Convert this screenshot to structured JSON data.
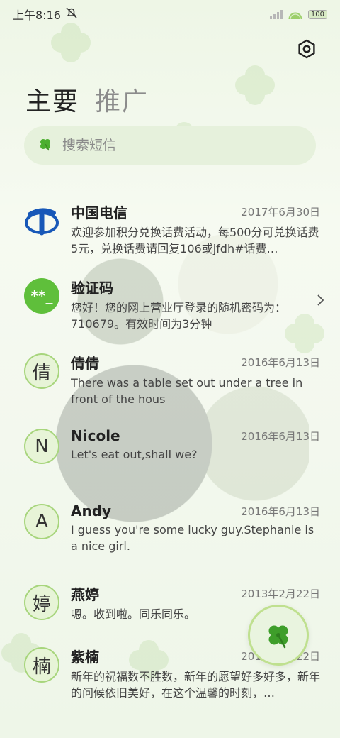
{
  "status_bar": {
    "time": "上午8:16",
    "battery": "100"
  },
  "tabs": [
    {
      "label": "主要"
    },
    {
      "label": "推广"
    }
  ],
  "search": {
    "placeholder": "搜索短信"
  },
  "conversations": [
    {
      "name": "中国电信",
      "date": "2017年6月30日",
      "preview": "欢迎参加积分兑换话费活动，每500分可兑换话费5元，兑换话费请回复106或jfdh#话费…",
      "avatar": ""
    },
    {
      "name": "验证码",
      "date": "",
      "preview": "您好！您的网上营业厅登录的随机密码为：710679。有效时间为3分钟",
      "avatar": "**_"
    },
    {
      "name": "倩倩",
      "date": "2016年6月13日",
      "preview": "There was a table set out under a tree in front of the hous",
      "avatar": "倩"
    },
    {
      "name": "Nicole",
      "date": "2016年6月13日",
      "preview": "Let's eat out,shall we?",
      "avatar": "N"
    },
    {
      "name": "Andy",
      "date": "2016年6月13日",
      "preview": "I guess you're some lucky guy.Stephanie is a nice girl.",
      "avatar": "A"
    },
    {
      "name": "燕婷",
      "date": "2013年2月22日",
      "preview": "嗯。收到啦。同乐同乐。",
      "avatar": "婷"
    },
    {
      "name": "紫楠",
      "date": "2013年2月22日",
      "preview": "新年的祝福数不胜数，新年的愿望好多好多，新年的问候依旧美好，在这个温馨的时刻，…",
      "avatar": "楠"
    }
  ],
  "colors": {
    "accent": "#5fbf3b",
    "avatar_bg": "#e7f4d7",
    "search_bg": "#e6f1dc"
  }
}
